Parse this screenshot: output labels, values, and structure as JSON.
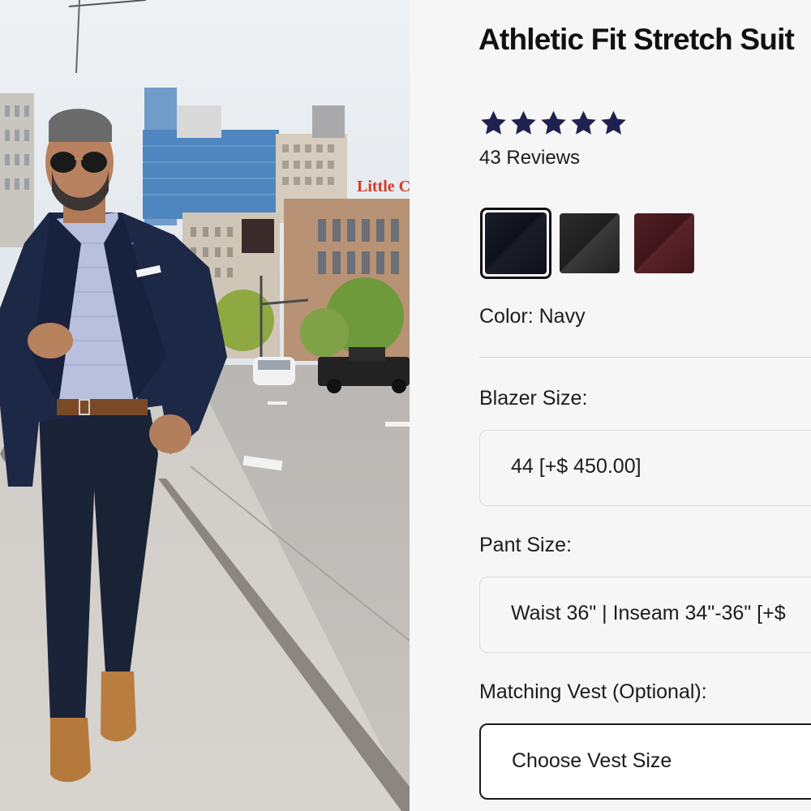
{
  "product": {
    "title": "Athletic Fit Stretch Suit",
    "rating_stars": 5,
    "reviews": "43 Reviews"
  },
  "photo": {
    "description_icon": "product-model-photo",
    "sign_text": "Little Caes"
  },
  "colors": {
    "label": "Color: Navy",
    "swatches": [
      {
        "name": "navy",
        "color": "#12141d",
        "selected": true
      },
      {
        "name": "black",
        "color": "#262626",
        "selected": false
      },
      {
        "name": "burgundy",
        "color": "#4a1d22",
        "selected": false
      }
    ]
  },
  "blazer": {
    "label": "Blazer Size:",
    "value": "44 [+$ 450.00]"
  },
  "pant": {
    "label": "Pant Size:",
    "value": "Waist 36\" | Inseam 34\"-36\" [+$ "
  },
  "vest": {
    "label": "Matching Vest (Optional):",
    "value": "Choose Vest Size"
  },
  "theme": {
    "star_color": "#1f2150",
    "accent": "#111111"
  }
}
